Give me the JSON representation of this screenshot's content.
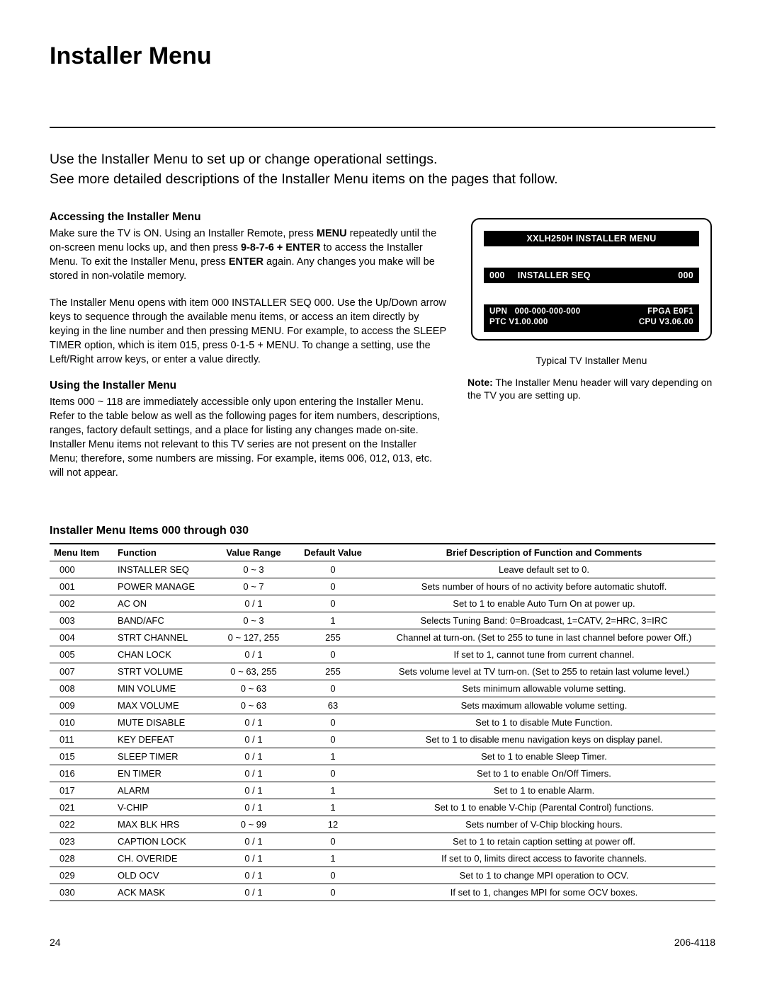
{
  "title": "Installer Menu",
  "intro_line1": "Use the Installer Menu to set up or change operational settings.",
  "intro_line2": "See more detailed descriptions of the Installer Menu items on the pages that follow.",
  "sec1_heading": "Accessing the Installer Menu",
  "sec1_p1_a": "Make sure the TV is ON. Using an Installer Remote, press ",
  "sec1_p1_b_MENU": "MENU",
  "sec1_p1_c": " repeatedly until the on-screen menu locks up, and then press ",
  "sec1_p1_d_key": "9-8-7-6 + ENTER",
  "sec1_p1_e": " to access the Installer Menu. To exit the Installer Menu, press ",
  "sec1_p1_f_ENTER": "ENTER",
  "sec1_p1_g": " again. Any changes you make will be stored in non-volatile memory.",
  "sec1_p2": "The Installer Menu opens with item 000 INSTALLER SEQ 000. Use the Up/Down arrow keys to sequence through the available menu items, or access an item directly by keying in the line number and then pressing MENU. For example, to access the SLEEP TIMER option, which is item 015, press 0-1-5 + MENU. To change a setting, use the Left/Right arrow keys, or enter a value directly.",
  "sec2_heading": "Using the Installer Menu",
  "sec2_p1": "Items 000 ~ 118 are immediately accessible only upon entering the Installer Menu. Refer to the table below as well as the following pages for item numbers, descriptions, ranges, factory default settings, and a place for listing any changes made on-site. Installer Menu items not relevant to this TV series are not present on the Installer Menu; therefore, some numbers are missing. For example, items 006, 012, 013, etc. will not appear.",
  "osd": {
    "title": "XXLH250H INSTALLER MENU",
    "mid_left_num": "000",
    "mid_left_label": "INSTALLER SEQ",
    "mid_right": "000",
    "upn_label": "UPN",
    "upn_value": "000-000-000-000",
    "fpga": "FPGA E0F1",
    "ptc": "PTC V1.00.000",
    "cpu": "CPU V3.06.00"
  },
  "osd_caption": "Typical TV Installer Menu",
  "osd_note_b": "Note:",
  "osd_note_rest": " The Installer Menu header will vary depending on the TV you are setting up.",
  "table_heading": "Installer Menu Items 000 through 030",
  "headers": {
    "h1": "Menu Item",
    "h2": "Function",
    "h3": "Value Range",
    "h4": "Default Value",
    "h5": "Brief Description of Function and Comments"
  },
  "rows": [
    {
      "item": "000",
      "func": "INSTALLER SEQ",
      "range": "0 ~ 3",
      "def": "0",
      "desc": "Leave default set to 0."
    },
    {
      "item": "001",
      "func": "POWER MANAGE",
      "range": "0 ~ 7",
      "def": "0",
      "desc": "Sets number of hours of no activity before automatic shutoff."
    },
    {
      "item": "002",
      "func": "AC ON",
      "range": "0 / 1",
      "def": "0",
      "desc": "Set to 1 to enable Auto Turn On at power up."
    },
    {
      "item": "003",
      "func": "BAND/AFC",
      "range": "0 ~ 3",
      "def": "1",
      "desc": "Selects Tuning Band: 0=Broadcast, 1=CATV, 2=HRC, 3=IRC"
    },
    {
      "item": "004",
      "func": "STRT CHANNEL",
      "range": "0 ~ 127, 255",
      "def": "255",
      "desc": "Channel at turn-on. (Set to 255 to tune in last channel before power Off.)"
    },
    {
      "item": "005",
      "func": "CHAN LOCK",
      "range": "0 / 1",
      "def": "0",
      "desc": "If set to 1, cannot tune from current channel."
    },
    {
      "item": "007",
      "func": "STRT VOLUME",
      "range": "0 ~ 63, 255",
      "def": "255",
      "desc": "Sets volume level at TV turn-on. (Set to 255 to retain last volume level.)"
    },
    {
      "item": "008",
      "func": "MIN VOLUME",
      "range": "0 ~ 63",
      "def": "0",
      "desc": "Sets minimum allowable volume setting."
    },
    {
      "item": "009",
      "func": "MAX VOLUME",
      "range": "0 ~ 63",
      "def": "63",
      "desc": "Sets maximum allowable volume setting."
    },
    {
      "item": "010",
      "func": "MUTE DISABLE",
      "range": "0 / 1",
      "def": "0",
      "desc": "Set to 1 to disable Mute Function."
    },
    {
      "item": "011",
      "func": "KEY DEFEAT",
      "range": "0 / 1",
      "def": "0",
      "desc": "Set to 1 to disable menu navigation keys on display panel."
    },
    {
      "item": "015",
      "func": "SLEEP TIMER",
      "range": "0 / 1",
      "def": "1",
      "desc": "Set to 1 to enable Sleep Timer."
    },
    {
      "item": "016",
      "func": "EN TIMER",
      "range": "0 / 1",
      "def": "0",
      "desc": "Set to 1 to enable On/Off Timers."
    },
    {
      "item": "017",
      "func": "ALARM",
      "range": "0 / 1",
      "def": "1",
      "desc": "Set to 1 to enable Alarm."
    },
    {
      "item": "021",
      "func": "V-CHIP",
      "range": "0 / 1",
      "def": "1",
      "desc": "Set to 1 to enable V-Chip (Parental Control) functions."
    },
    {
      "item": "022",
      "func": "MAX BLK HRS",
      "range": "0 ~ 99",
      "def": "12",
      "desc": "Sets number of V-Chip blocking hours."
    },
    {
      "item": "023",
      "func": "CAPTION LOCK",
      "range": "0 / 1",
      "def": "0",
      "desc": "Set to 1 to retain caption setting at power off."
    },
    {
      "item": "028",
      "func": "CH. OVERIDE",
      "range": "0 / 1",
      "def": "1",
      "desc": "If set to 0, limits direct access to favorite channels."
    },
    {
      "item": "029",
      "func": "OLD OCV",
      "range": "0 / 1",
      "def": "0",
      "desc": "Set to 1 to change MPI operation to OCV."
    },
    {
      "item": "030",
      "func": "ACK MASK",
      "range": "0 / 1",
      "def": "0",
      "desc": "If set to 1, changes MPI for some OCV boxes."
    }
  ],
  "page_number": "24",
  "doc_id": "206-4118"
}
